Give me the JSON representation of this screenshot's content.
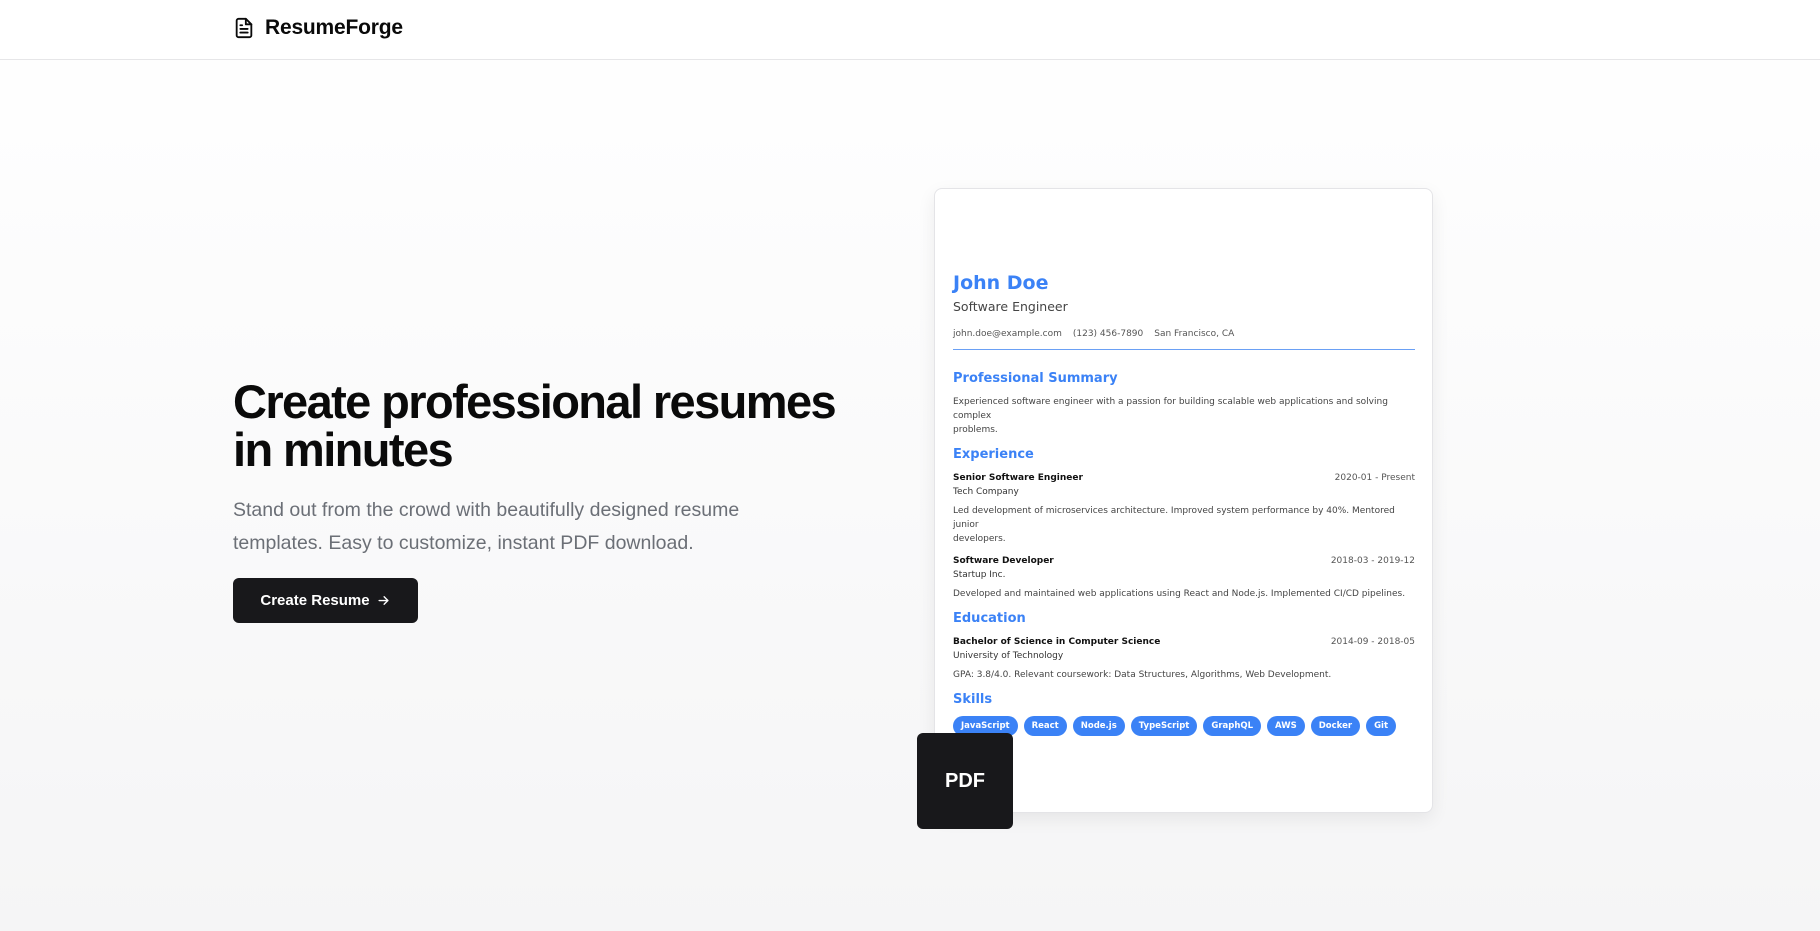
{
  "header": {
    "brand_icon": "document-icon",
    "brand_name": "ResumeForge"
  },
  "hero": {
    "title_line1": "Create professional resumes",
    "title_line2": "in minutes",
    "subtitle_line1": "Stand out from the crowd with beautifully designed resume",
    "subtitle_line2": "templates. Easy to customize, instant PDF download.",
    "cta_label": "Create Resume",
    "cta_icon": "arrow-right-icon"
  },
  "resume": {
    "name": "John Doe",
    "role": "Software Engineer",
    "email": "john.doe@example.com",
    "phone": "(123) 456-7890",
    "location": "San Francisco, CA",
    "summary_heading": "Professional Summary",
    "summary_line1": "Experienced software engineer with a passion for building scalable web applications and solving complex",
    "summary_line2": "problems.",
    "experience_heading": "Experience",
    "experience": [
      {
        "title": "Senior Software Engineer",
        "dates": "2020-01 - Present",
        "company": "Tech Company",
        "desc_line1": "Led development of microservices architecture. Improved system performance by 40%. Mentored junior",
        "desc_line2": "developers."
      },
      {
        "title": "Software Developer",
        "dates": "2018-03 - 2019-12",
        "company": "Startup Inc.",
        "desc_line1": "Developed and maintained web applications using React and Node.js. Implemented CI/CD pipelines."
      }
    ],
    "education_heading": "Education",
    "education": {
      "degree": "Bachelor of Science in Computer Science",
      "dates": "2014-09 - 2018-05",
      "school": "University of Technology",
      "details": "GPA: 3.8/4.0. Relevant coursework: Data Structures, Algorithms, Web Development."
    },
    "skills_heading": "Skills",
    "skills": [
      "JavaScript",
      "React",
      "Node.js",
      "TypeScript",
      "GraphQL",
      "AWS",
      "Docker",
      "Git"
    ]
  },
  "pdf_badge": {
    "label": "PDF"
  },
  "colors": {
    "accent": "#3b82f6",
    "dark": "#18181b",
    "muted_text": "#6b6f76"
  }
}
